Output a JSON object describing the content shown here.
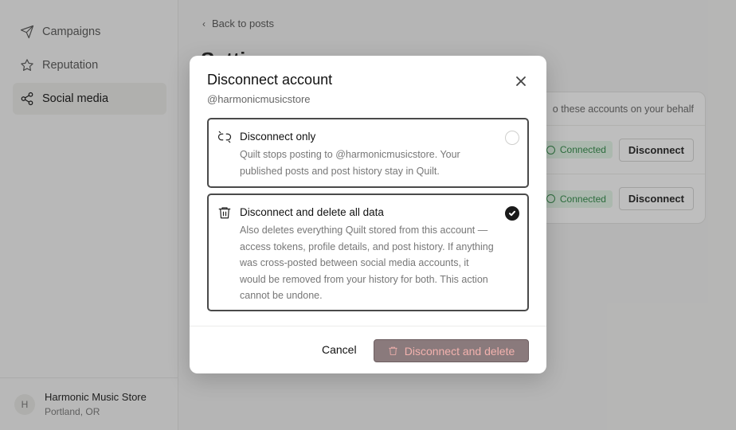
{
  "sidebar": {
    "items": [
      {
        "label": "Campaigns",
        "icon": "send-icon",
        "active": false
      },
      {
        "label": "Reputation",
        "icon": "star-icon",
        "active": false
      },
      {
        "label": "Social media",
        "icon": "share-icon",
        "active": true
      }
    ],
    "footer": {
      "avatar_initial": "H",
      "store_name": "Harmonic Music Store",
      "location": "Portland, OR"
    }
  },
  "main": {
    "back_label": "Back to posts",
    "page_title": "Setti",
    "card": {
      "header_text": "o these accounts on your behalf",
      "rows": [
        {
          "status": "Connected",
          "action": "Disconnect"
        },
        {
          "status": "Connected",
          "action": "Disconnect"
        }
      ]
    }
  },
  "modal": {
    "title": "Disconnect account",
    "subtitle": "@harmonicmusicstore",
    "options": [
      {
        "title": "Disconnect only",
        "description": "Quilt stops posting to @harmonicmusicstore. Your published posts and post history stay in Quilt.",
        "selected": false,
        "icon": "unlink-icon"
      },
      {
        "title": "Disconnect and delete all data",
        "description": "Also deletes everything Quilt stored from this account — access tokens, profile details, and post history. If anything was cross-posted between social media accounts, it would be removed from your history for both. This action cannot be undone.",
        "selected": true,
        "icon": "trash-icon"
      }
    ],
    "cancel_label": "Cancel",
    "confirm_label": "Disconnect and delete"
  },
  "colors": {
    "connected_bg": "#e4f6e8",
    "connected_text": "#2f8a47",
    "danger_button_bg": "#8a7a7c",
    "danger_button_text": "#f3b2ae"
  }
}
